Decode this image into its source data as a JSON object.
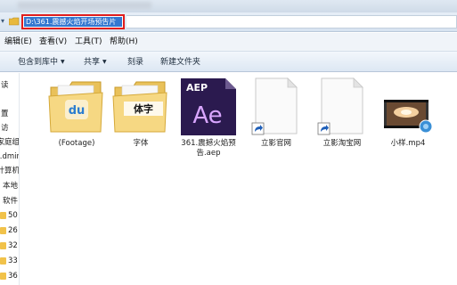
{
  "address_bar": {
    "path": "D:\\361.震撼火焰开场预告片"
  },
  "menu": {
    "items": [
      {
        "label": "编辑(E)"
      },
      {
        "label": "查看(V)"
      },
      {
        "label": "工具(T)"
      },
      {
        "label": "帮助(H)"
      }
    ]
  },
  "toolbar": {
    "include_library": "包含到库中",
    "share": "共享",
    "burn": "刻录",
    "new_folder": "新建文件夹"
  },
  "sidebar": {
    "items": [
      {
        "label": "读"
      },
      {
        "label": "置"
      },
      {
        "label": "访"
      },
      {
        "label": "家庭组"
      },
      {
        "label": "计算机"
      },
      {
        "label": "本地"
      },
      {
        "label": "软件"
      },
      {
        "label": "50"
      },
      {
        "label": "26"
      },
      {
        "label": "32"
      },
      {
        "label": "33"
      },
      {
        "label": "36"
      }
    ],
    "admin_label": ".dmir"
  },
  "files": [
    {
      "name": "(Footage)",
      "icon": "folder-du-icon",
      "badge": "du"
    },
    {
      "name": "字体",
      "icon": "folder-font-icon",
      "badge": "体字"
    },
    {
      "name": "361.震撼火焰预告.aep",
      "icon": "after-effects-file-icon",
      "badge_top": "AEP",
      "badge_main": "Ae"
    },
    {
      "name": "立影官网",
      "icon": "shortcut-icon"
    },
    {
      "name": "立影淘宝网",
      "icon": "shortcut-icon"
    },
    {
      "name": "小样.mp4",
      "icon": "video-file-icon"
    }
  ],
  "colors": {
    "accent": "#3478d0",
    "highlight_border": "#e01e1e",
    "folder": "#f1c24a",
    "ae_purple": "#2b1a4f",
    "ae_text": "#d9a6ff"
  }
}
